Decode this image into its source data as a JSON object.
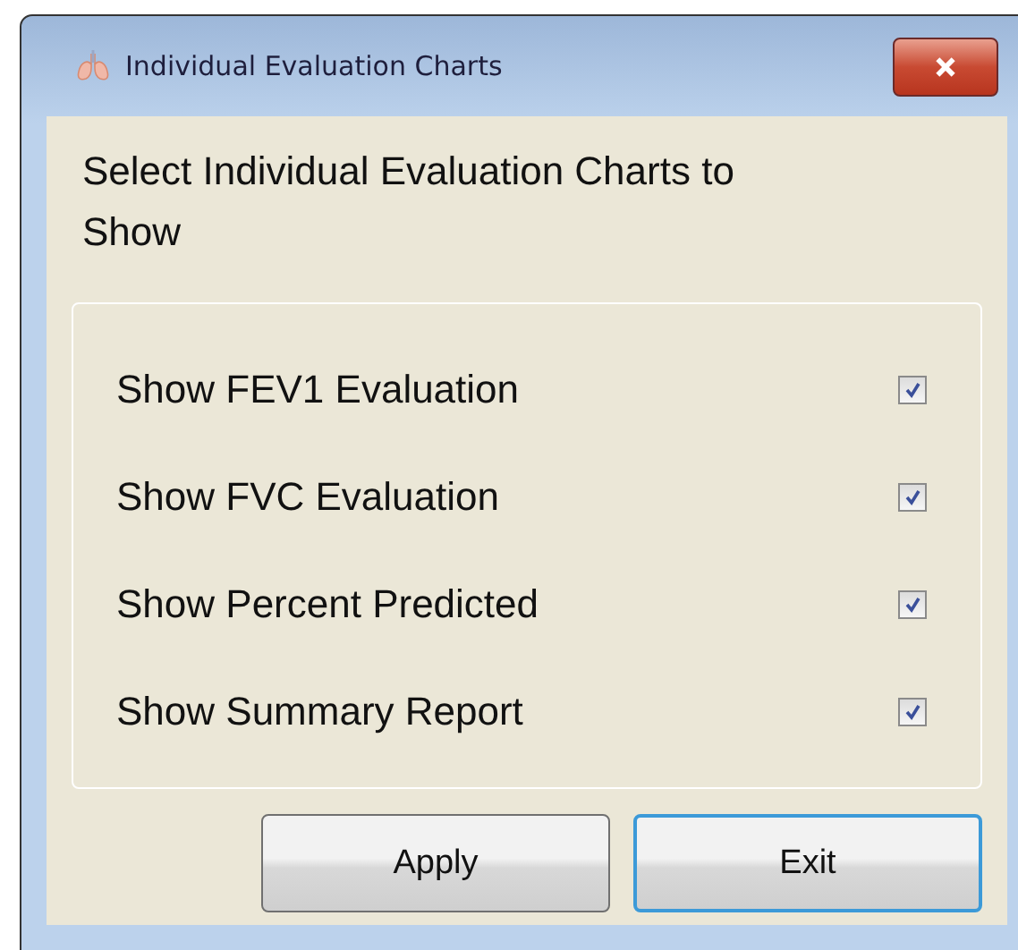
{
  "window": {
    "title": "Individual Evaluation Charts"
  },
  "heading": "Select Individual Evaluation Charts to Show",
  "options": [
    {
      "label": "Show FEV1 Evaluation",
      "checked": true
    },
    {
      "label": "Show FVC Evaluation",
      "checked": true
    },
    {
      "label": "Show Percent Predicted",
      "checked": true
    },
    {
      "label": "Show Summary Report",
      "checked": true
    }
  ],
  "buttons": [
    {
      "label": "Apply",
      "default": false
    },
    {
      "label": "Exit",
      "default": true
    }
  ]
}
